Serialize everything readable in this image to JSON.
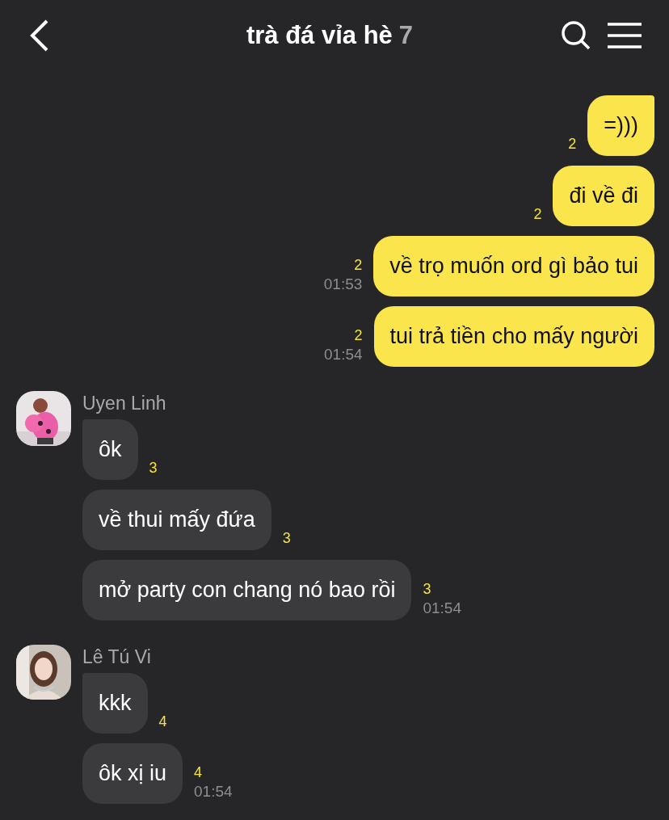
{
  "header": {
    "title": "trà đá vỉa hè",
    "member_count": "7"
  },
  "groups": [
    {
      "kind": "outgoing",
      "messages": [
        {
          "text": "=)))",
          "unread": "2"
        },
        {
          "text": "đi về đi",
          "unread": "2"
        },
        {
          "text": "về trọ muốn ord gì bảo tui",
          "unread": "2",
          "time": "01:53"
        },
        {
          "text": "tui trả tiền cho mấy người",
          "unread": "2",
          "time": "01:54"
        }
      ]
    },
    {
      "kind": "incoming",
      "sender": "Uyen Linh",
      "avatar": {
        "kind": "picture"
      },
      "messages": [
        {
          "text": "ôk",
          "unread": "3"
        },
        {
          "text": "về thui mấy đứa",
          "unread": "3"
        },
        {
          "text": "mở party con chang nó bao rồi",
          "unread": "3",
          "time": "01:54"
        }
      ]
    },
    {
      "kind": "incoming",
      "sender": "Lê Tú Vi",
      "avatar": {
        "kind": "picture"
      },
      "messages": [
        {
          "text": "kkk",
          "unread": "4"
        },
        {
          "text": "ôk xị iu",
          "unread": "4",
          "time": "01:54"
        }
      ]
    }
  ]
}
